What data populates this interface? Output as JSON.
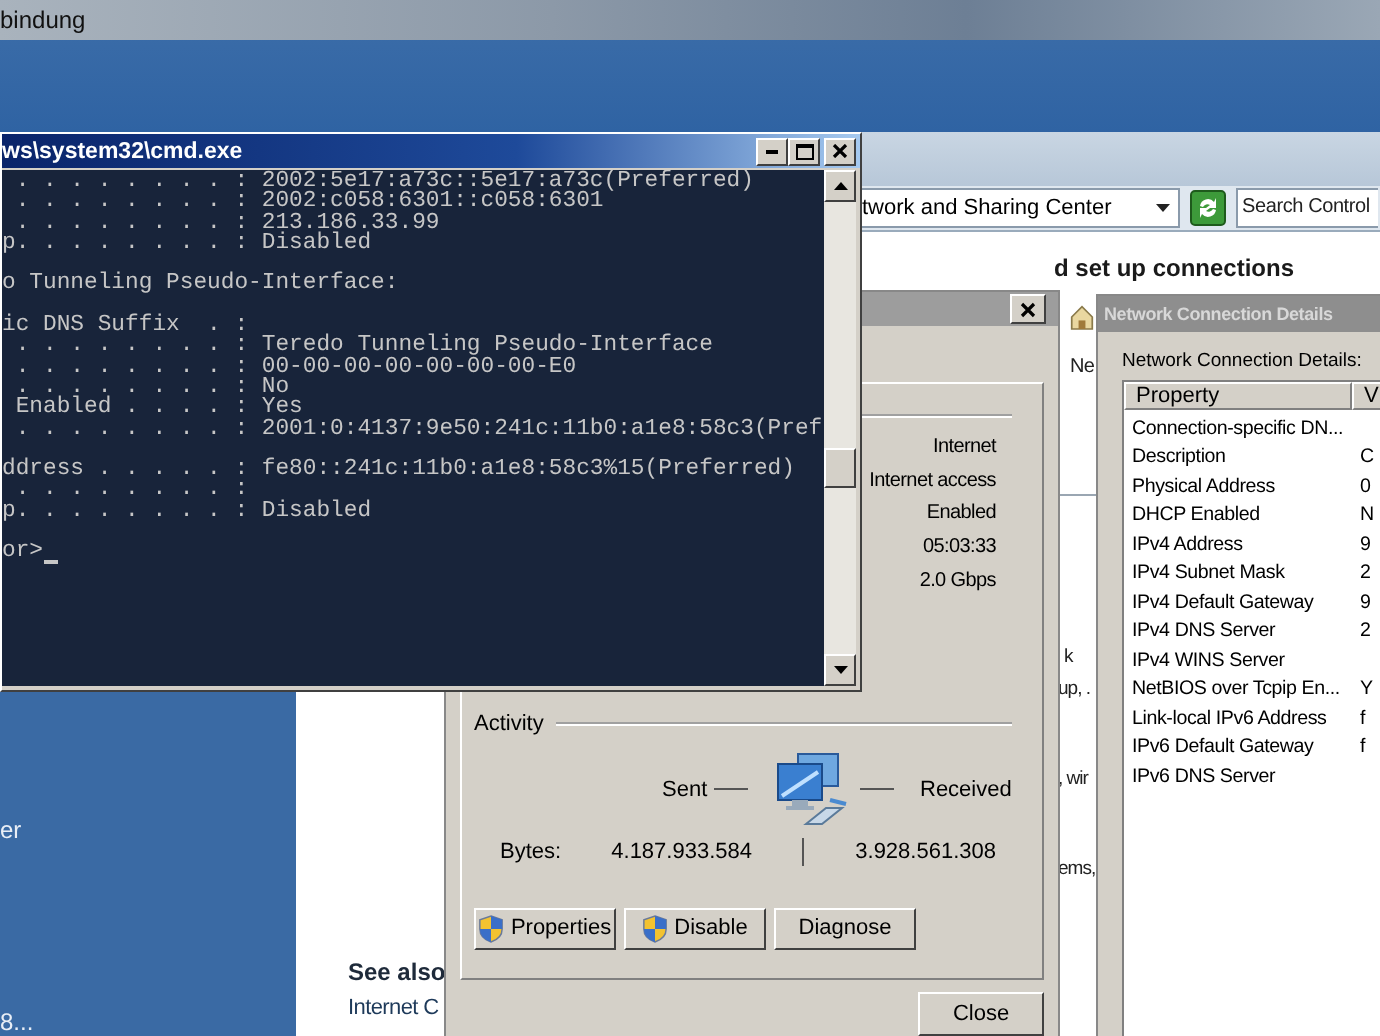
{
  "back_window": {
    "title": "bindung"
  },
  "control_panel": {
    "address": "twork and Sharing Center",
    "search": {
      "placeholder": "Search Control"
    },
    "heading": "d set up connections",
    "sidebar_texts": [
      "er",
      "8..."
    ],
    "network_label": "Ne",
    "paragraphs": [
      [
        "k",
        "up, ."
      ],
      [
        ", wir"
      ],
      [
        "ems,"
      ]
    ],
    "see_also": {
      "title": "See also",
      "links": [
        "Internet C"
      ]
    }
  },
  "cmd": {
    "title": "ws\\system32\\cmd.exe",
    "blocks": [
      [
        " . . . . . . . . : 2002:5e17:a73c::5e17:a73c(Preferred)",
        " . . . . . . . . : 2002:c058:6301::c058:6301",
        " . . . . . . . . : 213.186.33.99",
        "p. . . . . . . . : Disabled"
      ],
      [
        "o Tunneling Pseudo-Interface:"
      ],
      [
        "ic DNS Suffix  . :",
        " . . . . . . . . : Teredo Tunneling Pseudo-Interface",
        " . . . . . . . . : 00-00-00-00-00-00-00-E0",
        " . . . . . . . . : No",
        " Enabled . . . . : Yes",
        " . . . . . . . . : 2001:0:4137:9e50:241c:11b0:a1e8:58c3(Pref"
      ],
      [
        "ddress . . . . . : fe80::241c:11b0:a1e8:58c3%15(Preferred)",
        " . . . . . . . . :",
        "p. . . . . . . . : Disabled"
      ]
    ],
    "prompt": "or>"
  },
  "status_dialog": {
    "details": [
      "Internet",
      "Internet access",
      "Enabled",
      "05:03:33",
      "2.0 Gbps"
    ],
    "activity": {
      "title": "Activity",
      "sent_label": "Sent",
      "received_label": "Received",
      "bytes_label": "Bytes:",
      "sent": "4.187.933.584",
      "received": "3.928.561.308"
    },
    "buttons": [
      {
        "label": "Properties",
        "shield": true
      },
      {
        "label": "Disable",
        "shield": true
      },
      {
        "label": "Diagnose",
        "shield": false
      }
    ],
    "close": "Close"
  },
  "details_dialog": {
    "title": "Network Connection Details",
    "label": "Network Connection Details:",
    "columns": [
      "Property",
      "V"
    ],
    "rows": [
      {
        "property": "Connection-specific DN..."
      },
      {
        "property": "Description",
        "value": "C"
      },
      {
        "property": "Physical Address",
        "value": "0"
      },
      {
        "property": "DHCP Enabled",
        "value": "N"
      },
      {
        "property": "IPv4 Address",
        "value": "9"
      },
      {
        "property": "IPv4 Subnet Mask",
        "value": "2"
      },
      {
        "property": "IPv4 Default Gateway",
        "value": "9"
      },
      {
        "property": "IPv4 DNS Server",
        "value": "2"
      },
      {
        "property": "IPv4 WINS Server"
      },
      {
        "property": "NetBIOS over Tcpip En...",
        "value": "Y"
      },
      {
        "property": "Link-local IPv6 Address",
        "value": "f"
      },
      {
        "property": "IPv6 Default Gateway",
        "value": "f"
      },
      {
        "property": "IPv6 DNS Server"
      }
    ]
  }
}
